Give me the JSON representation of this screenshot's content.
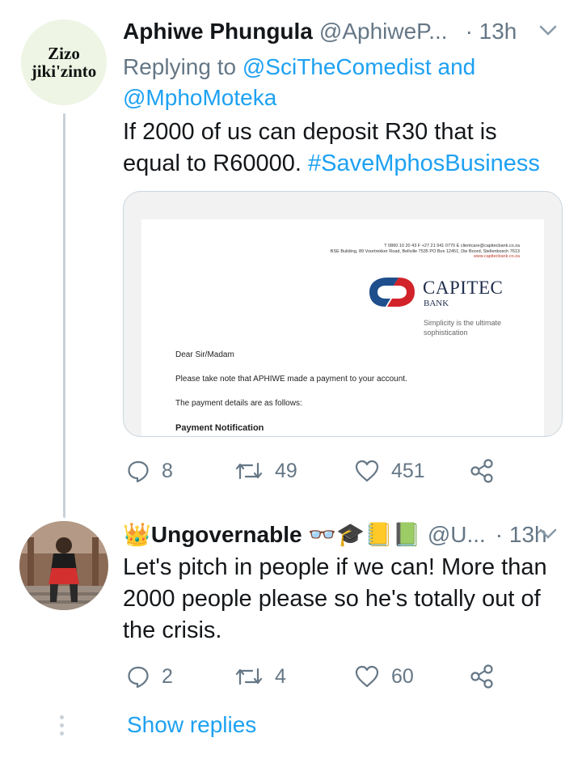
{
  "tweets": [
    {
      "avatar_text": {
        "line1": "Zizo",
        "line2": "jiki'zinto"
      },
      "name": "Aphiwe Phungula",
      "handle": "@AphiweP...",
      "time": "· 13h",
      "replying_prefix": "Replying to",
      "replying_mentions": [
        "@SciTheComedist",
        "and",
        "@MphoMoteka"
      ],
      "text_line1": "If 2000 of us can deposit R30 that is",
      "text_line2_plain": "equal to R60000.",
      "hashtag": "#SaveMphosBusiness",
      "stats": {
        "replies": "8",
        "retweets": "49",
        "likes": "451"
      }
    },
    {
      "name": "👑Ungovernable 👓🎓📒📗",
      "handle": "@U...",
      "time": "· 13h",
      "text_line1": "Let's pitch in people if we can! More than",
      "text_line2": "2000 people please so he's totally out of",
      "text_line3": "the crisis.",
      "stats": {
        "replies": "2",
        "retweets": "4",
        "likes": "60"
      }
    }
  ],
  "attachment": {
    "contact_line": "T 0860 10 20 43  F +27 21 941 0770  E clientcare@capitecbank.co.za",
    "address_line": "BSE Building, 89 Voortrekker Road, Bellville 7535  PO Box 12451, Die Boord, Stellenbosch 7613",
    "web_line": "www.capitecbank.co.za",
    "brand": "CAPITEC",
    "brand_sub": "BANK",
    "tagline": "Simplicity is the ultimate sophistication",
    "salutation": "Dear Sir/Madam",
    "line1": "Please take note that APHIWE made a payment to your account.",
    "line2": "The payment details are as follows:",
    "heading": "Payment Notification",
    "logo_colors": {
      "red": "#d2232a",
      "blue": "#1f4e8c"
    }
  },
  "show_replies": "Show replies",
  "colors": {
    "link": "#1da1f2",
    "muted": "#657786",
    "text": "#14171a",
    "thread": "#c9d1d8"
  }
}
